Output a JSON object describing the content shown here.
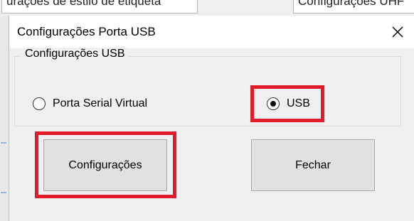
{
  "background": {
    "tab_left": "urações de estilo de etiqueta",
    "tab_right": "Configurações UHF"
  },
  "dialog": {
    "title": "Configurações Porta USB",
    "close_glyph": "✕"
  },
  "group": {
    "label": "Configurações USB",
    "options": [
      {
        "label": "Porta Serial Virtual",
        "selected": false
      },
      {
        "label": "USB",
        "selected": true
      }
    ]
  },
  "buttons": {
    "configure_label": "Configurações",
    "close_label": "Fechar"
  },
  "colors": {
    "highlight": "#e11b2a",
    "dialog_bg": "#f0f0f0",
    "titlebar_bg": "#ffffff",
    "button_bg": "#e1e1e1"
  },
  "icons": {
    "close": "close-icon"
  }
}
